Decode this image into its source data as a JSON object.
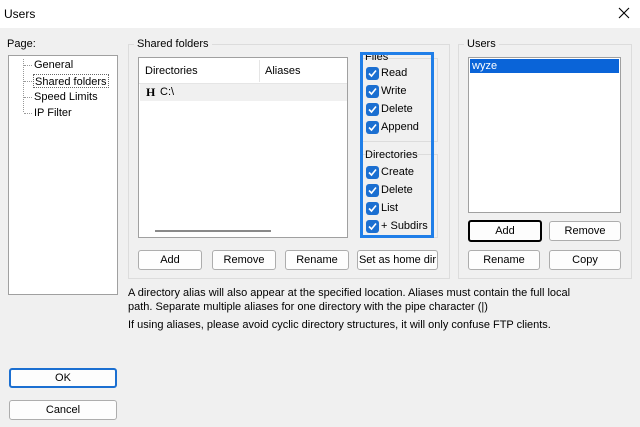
{
  "window": {
    "title": "Users"
  },
  "page_label": "Page:",
  "page_tree": [
    {
      "label": "General",
      "selected": false
    },
    {
      "label": "Shared folders",
      "selected": true
    },
    {
      "label": "Speed Limits",
      "selected": false
    },
    {
      "label": "IP Filter",
      "selected": false
    }
  ],
  "shared_folders": {
    "group_label": "Shared folders",
    "columns": {
      "directories": "Directories",
      "aliases": "Aliases"
    },
    "rows": [
      {
        "home_marker": "H",
        "directory": "C:\\",
        "alias": ""
      }
    ],
    "buttons": {
      "add": "Add",
      "remove": "Remove",
      "rename": "Rename",
      "set_home": "Set as home dir"
    }
  },
  "files": {
    "label": "Files",
    "options": [
      {
        "label": "Read",
        "checked": true
      },
      {
        "label": "Write",
        "checked": true
      },
      {
        "label": "Delete",
        "checked": true
      },
      {
        "label": "Append",
        "checked": true
      }
    ]
  },
  "directories": {
    "label": "Directories",
    "options": [
      {
        "label": "Create",
        "checked": true
      },
      {
        "label": "Delete",
        "checked": true
      },
      {
        "label": "List",
        "checked": true
      },
      {
        "label": "+ Subdirs",
        "checked": true
      }
    ]
  },
  "users": {
    "label": "Users",
    "items": [
      {
        "name": "wyze",
        "selected": true
      }
    ],
    "buttons": {
      "add": "Add",
      "remove": "Remove",
      "rename": "Rename",
      "copy": "Copy"
    }
  },
  "info": {
    "line1": "A directory alias will also appear at the specified location. Aliases must contain the full local",
    "line2": "path. Separate multiple aliases for one directory with the pipe character (|)",
    "line3": "If using aliases, please avoid cyclic directory structures, it will only confuse FTP clients."
  },
  "dialog_buttons": {
    "ok": "OK",
    "cancel": "Cancel"
  },
  "colors": {
    "accent": "#1b6fd1",
    "highlight_border": "#1f7ee8",
    "selection": "#0a64d8"
  }
}
